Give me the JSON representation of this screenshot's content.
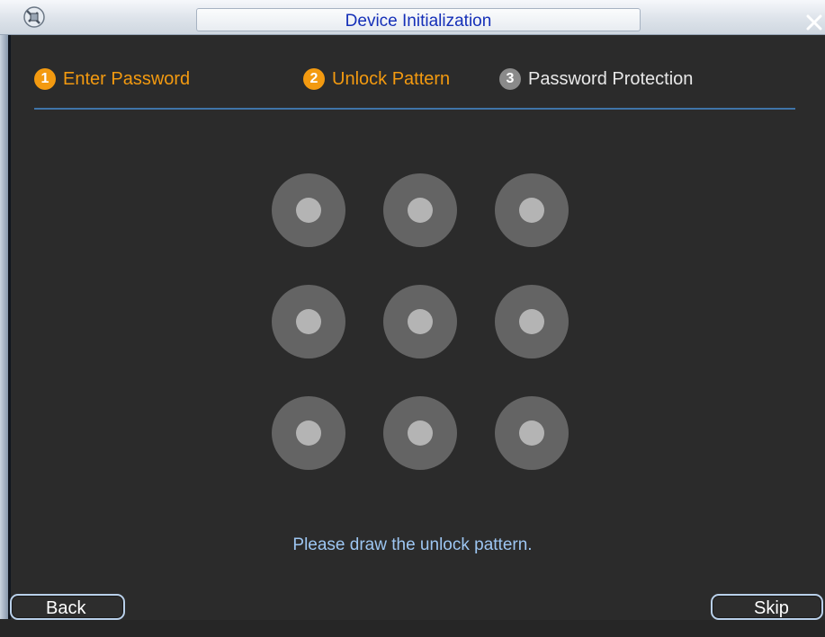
{
  "window": {
    "title": "Device Initialization",
    "app_icon": "camera-icon",
    "close_icon": "close-icon"
  },
  "steps": [
    {
      "number": "1",
      "label": "Enter Password",
      "state": "active"
    },
    {
      "number": "2",
      "label": "Unlock Pattern",
      "state": "active"
    },
    {
      "number": "3",
      "label": "Password Protection",
      "state": "inactive"
    }
  ],
  "pattern": {
    "rows": 3,
    "cols": 3
  },
  "hint": "Please draw the unlock pattern.",
  "buttons": {
    "back": "Back",
    "skip": "Skip"
  },
  "colors": {
    "active_step": "#f39a10",
    "inactive_step": "#8a8a8a",
    "hint_text": "#9dc6f2",
    "title_text": "#1530b8",
    "background": "#2b2b2b",
    "divider": "#3f74a8"
  }
}
